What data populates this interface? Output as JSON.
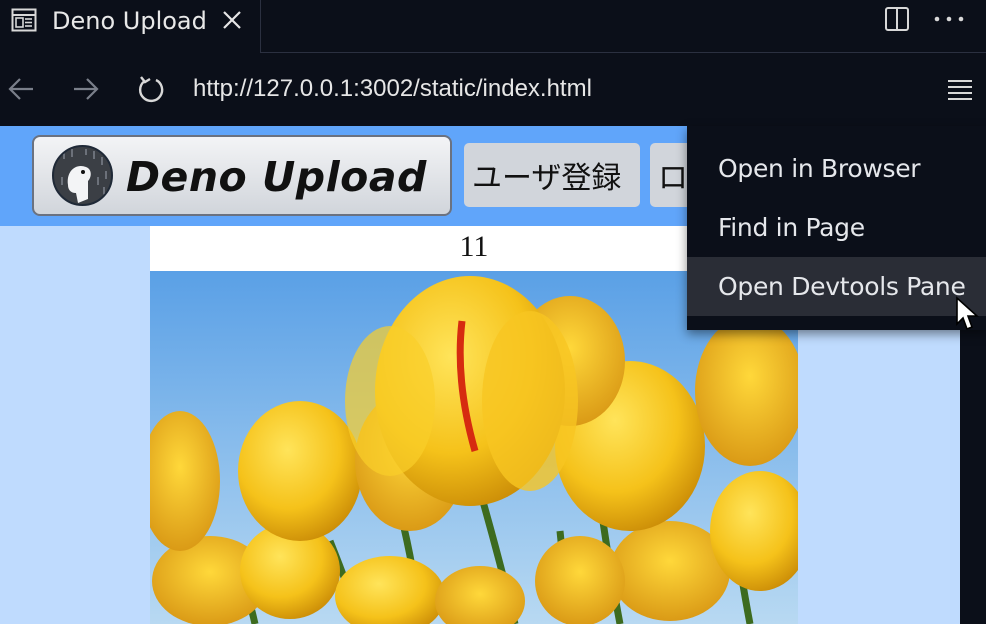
{
  "tab": {
    "title": "Deno Upload",
    "page_icon": "page-layout-icon",
    "close_icon": "close-icon"
  },
  "toolbar": {
    "split_icon": "split-view-icon",
    "more_icon": "more-horizontal-icon"
  },
  "navigation": {
    "back_icon": "arrow-left-icon",
    "forward_icon": "arrow-right-icon",
    "reload_icon": "reload-icon",
    "url": "http://127.0.0.1:3002/static/index.html",
    "menu_icon": "hamburger-menu-icon"
  },
  "site": {
    "logo_text": "Deno Upload",
    "logo_icon": "deno-dinosaur-icon",
    "nav_buttons": [
      "ユーザ登録",
      "ログイン"
    ],
    "counter": "11",
    "image": "yellow-tulips-photo"
  },
  "context_menu": {
    "items": [
      "Open in Browser",
      "Find in Page",
      "Open Devtools Pane"
    ],
    "hovered_index": 2
  },
  "colors": {
    "chrome_bg": "#0b0f19",
    "header_blue": "#60a5fa",
    "page_bg": "#bfdbfe",
    "menu_hover": "#2a2d36"
  }
}
